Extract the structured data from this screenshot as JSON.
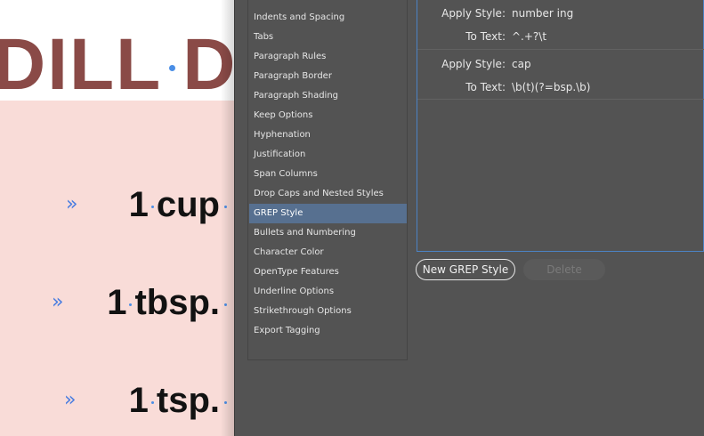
{
  "document": {
    "heading_left": "DILL",
    "heading_right": "D",
    "measures": [
      {
        "chevron": "»",
        "num": "1",
        "unit": "cup"
      },
      {
        "chevron": "»",
        "num": "1",
        "unit": "tbsp."
      },
      {
        "chevron": "»",
        "num": "1",
        "unit": "tsp."
      }
    ]
  },
  "dialog": {
    "categories": [
      "Indents and Spacing",
      "Tabs",
      "Paragraph Rules",
      "Paragraph Border",
      "Paragraph Shading",
      "Keep Options",
      "Hyphenation",
      "Justification",
      "Span Columns",
      "Drop Caps and Nested Styles",
      "GREP Style",
      "Bullets and Numbering",
      "Character Color",
      "OpenType Features",
      "Underline Options",
      "Strikethrough Options",
      "Export Tagging"
    ],
    "selected_category": "GREP Style",
    "grep_rules": [
      {
        "apply_label": "Apply Style:",
        "apply_value": "number ing",
        "to_label": "To Text:",
        "to_value": "^.+?\\t"
      },
      {
        "apply_label": "Apply Style:",
        "apply_value": "cap",
        "to_label": "To Text:",
        "to_value": "\\b(t)(?=bsp.\\b)"
      }
    ],
    "buttons": {
      "new_grep": "New GREP Style",
      "delete": "Delete"
    }
  },
  "colors": {
    "heading": "#8a4a47",
    "pink_background": "#f9dcd8",
    "selection": "#577090",
    "panel": "#535353",
    "accent_blue": "#4a7de0"
  }
}
